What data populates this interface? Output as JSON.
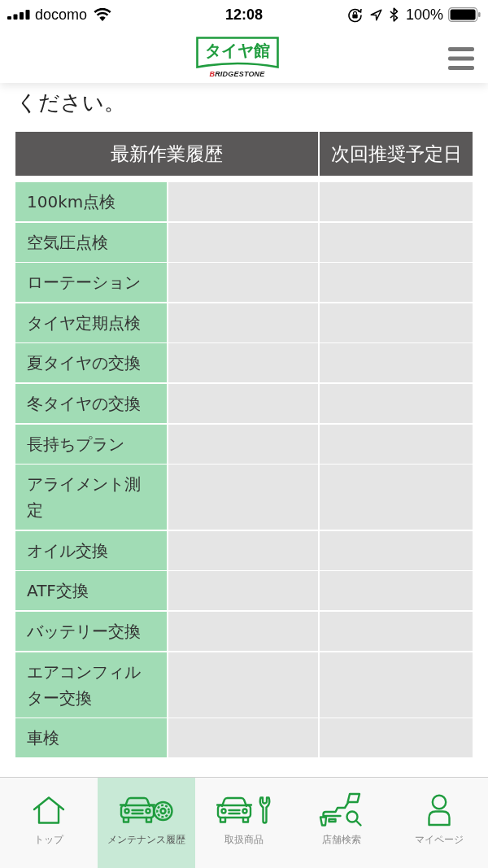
{
  "status_bar": {
    "carrier": "docomo",
    "time": "12:08",
    "battery": "100%"
  },
  "header": {
    "logo_text": "タイヤ館",
    "brand": "BRIDGESTONE"
  },
  "intro_text": "ください。",
  "table": {
    "columns": [
      "最新作業履歴",
      "次回推奨予定日"
    ],
    "rows": [
      {
        "label": "100km点検"
      },
      {
        "label": "空気圧点検"
      },
      {
        "label": "ローテーション"
      },
      {
        "label": "タイヤ定期点検"
      },
      {
        "label": "夏タイヤの交換"
      },
      {
        "label": "冬タイヤの交換"
      },
      {
        "label": "長持ちプラン"
      },
      {
        "label": "アライメント測定"
      },
      {
        "label": "オイル交換"
      },
      {
        "label": "ATF交換"
      },
      {
        "label": "バッテリー交換"
      },
      {
        "label": "エアコンフィルター交換"
      },
      {
        "label": "車検"
      }
    ]
  },
  "tab_bar": {
    "items": [
      {
        "kind": "home",
        "label": "トップ",
        "selected": false
      },
      {
        "kind": "maintenance",
        "label": "メンテナンス履歴",
        "selected": true
      },
      {
        "kind": "products",
        "label": "取扱商品",
        "selected": false
      },
      {
        "kind": "stores",
        "label": "店舗検索",
        "selected": false
      },
      {
        "kind": "account",
        "label": "マイページ",
        "selected": false
      }
    ]
  }
}
